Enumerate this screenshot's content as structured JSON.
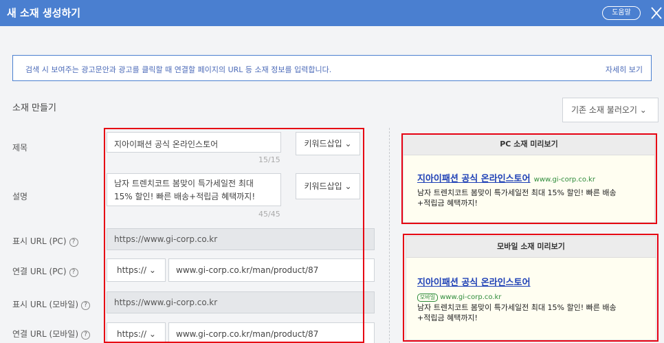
{
  "header": {
    "title": "새 소재 생성하기",
    "help_label": "도움말"
  },
  "info": {
    "text": "검색 시 보여주는 광고문안과 광고를 클릭할 때 연결할 페이지의 URL 등 소재 정보를 입력합니다.",
    "link": "자세히 보기"
  },
  "section": {
    "title": "소재 만들기",
    "load_button": "기존 소재 불러오기 ⌄"
  },
  "form": {
    "title_label": "제목",
    "title_value": "지아이패션 공식 온라인스토어",
    "title_counter": "15/15",
    "desc_label": "설명",
    "desc_line1": "남자 트렌치코트 봄맞이 특가세일전 최대",
    "desc_line2": "15% 할인! 빠른 배송+적립금 혜택까지!",
    "desc_counter": "45/45",
    "keyword_button": "키워드삽입 ⌄",
    "display_url_pc_label": "표시 URL (PC)",
    "display_url_pc_value": "https://www.gi-corp.co.kr",
    "link_url_pc_label": "연결 URL (PC)",
    "protocol": "https:// ⌄",
    "link_url_pc_value": "www.gi-corp.co.kr/man/product/87",
    "display_url_mobile_label": "표시 URL (모바일)",
    "display_url_mobile_value": "https://www.gi-corp.co.kr",
    "link_url_mobile_label": "연결 URL (모바일)",
    "link_url_mobile_value": "www.gi-corp.co.kr/man/product/87",
    "help_mark": "?"
  },
  "pc_preview": {
    "header": "PC 소재 미리보기",
    "title": "지아이패션 공식 온라인스토어",
    "url": "www.gi-corp.co.kr",
    "desc_line1": "남자 트렌치코트 봄맞이 특가세일전 최대 15% 할인! 빠른 배송",
    "desc_line2": "+적립금 혜택까지!"
  },
  "mobile_preview": {
    "header": "모바일 소재 미리보기",
    "title": "지아이패션 공식 온라인스토어",
    "badge": "모바일",
    "url": "www.gi-corp.co.kr",
    "desc_line1": "남자 트렌치코트 봄맞이 특가세일전 최대 15% 할인! 빠른 배송",
    "desc_line2": "+적립금 혜택까지!"
  },
  "colors": {
    "header_bg": "#4a7fd0",
    "highlight": "#e60012",
    "ad_title": "#1d3fb6",
    "ad_url": "#2e8b3a",
    "preview_bg": "#fffef1"
  },
  "icons": {
    "close": "close-icon",
    "help": "question-circle-icon",
    "dropdown": "chevron-down-icon"
  }
}
